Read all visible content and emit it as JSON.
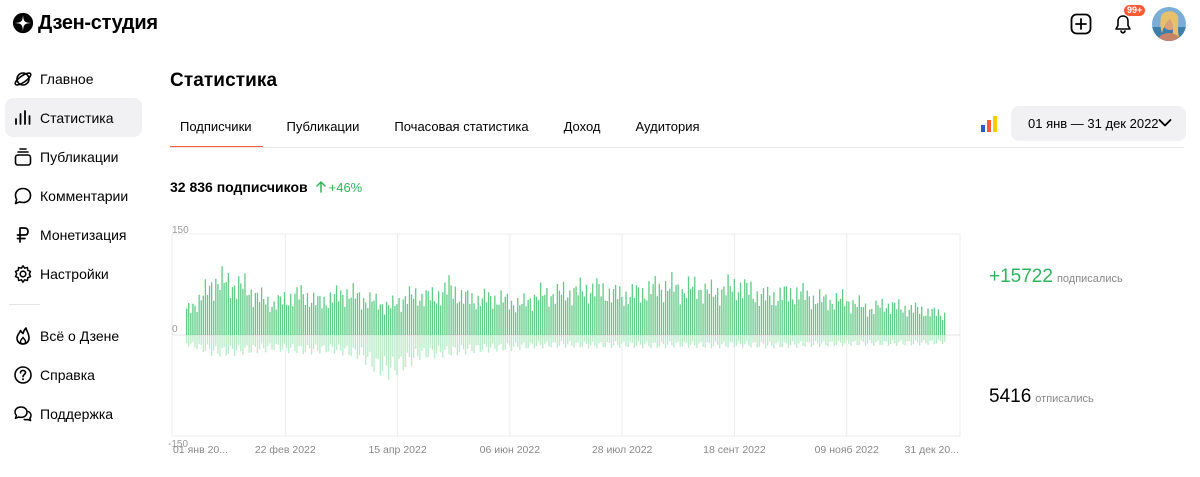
{
  "header": {
    "logo_text": "Дзен-студия",
    "notifications_badge": "99+",
    "icons": [
      "zen-logo-icon",
      "plus-square-icon",
      "bell-icon",
      "avatar"
    ]
  },
  "sidebar": {
    "items": [
      {
        "label": "Главное",
        "icon": "planet-icon"
      },
      {
        "label": "Статистика",
        "icon": "bar-chart-icon",
        "active": true
      },
      {
        "label": "Публикации",
        "icon": "stack-icon"
      },
      {
        "label": "Комментарии",
        "icon": "speech-bubble-icon"
      },
      {
        "label": "Монетизация",
        "icon": "ruble-icon"
      },
      {
        "label": "Настройки",
        "icon": "gear-icon"
      }
    ],
    "bottom_items": [
      {
        "label": "Всё о Дзене",
        "icon": "flame-icon"
      },
      {
        "label": "Справка",
        "icon": "question-circle-icon"
      },
      {
        "label": "Поддержка",
        "icon": "chat-bubbles-icon"
      }
    ]
  },
  "main": {
    "title": "Статистика",
    "tabs": [
      {
        "label": "Подписчики",
        "active": true
      },
      {
        "label": "Публикации"
      },
      {
        "label": "Почасовая статистика"
      },
      {
        "label": "Доход"
      },
      {
        "label": "Аудитория"
      }
    ],
    "date_range": "01 янв — 31 дек 2022",
    "subscribers_total": "32 836 подписчиков",
    "subscribers_growth": "+46%",
    "stats": {
      "subscribed_value": "+15722",
      "subscribed_label": "подписались",
      "unsubscribed_value": "5416",
      "unsubscribed_label": "отписались"
    }
  },
  "colors": {
    "accent": "#ff5a36",
    "positive": "#2fb35c",
    "bar_up": "#5fcb85",
    "bar_down": "#b9ebc8"
  },
  "chart_data": {
    "type": "bar",
    "ylim": [
      -150,
      150
    ],
    "ytick_labels": [
      "150",
      "0",
      "-150"
    ],
    "xtick_labels": [
      "01 янв 20...",
      "22 фев 2022",
      "15 апр 2022",
      "06 июн 2022",
      "28 июл 2022",
      "18 сент 2022",
      "09 нояб 2022",
      "31 дек 20..."
    ],
    "x_range": [
      "2022-01-01",
      "2022-12-31"
    ],
    "grid": true,
    "series": [
      {
        "name": "подписались",
        "points": [
          [
            0,
            35
          ],
          [
            7,
            55
          ],
          [
            14,
            80
          ],
          [
            21,
            75
          ],
          [
            28,
            70
          ],
          [
            35,
            55
          ],
          [
            42,
            45
          ],
          [
            49,
            55
          ],
          [
            56,
            60
          ],
          [
            63,
            48
          ],
          [
            70,
            55
          ],
          [
            77,
            62
          ],
          [
            84,
            54
          ],
          [
            91,
            48
          ],
          [
            98,
            42
          ],
          [
            105,
            55
          ],
          [
            112,
            58
          ],
          [
            119,
            55
          ],
          [
            126,
            70
          ],
          [
            133,
            55
          ],
          [
            140,
            52
          ],
          [
            147,
            55
          ],
          [
            154,
            50
          ],
          [
            161,
            45
          ],
          [
            168,
            58
          ],
          [
            175,
            60
          ],
          [
            182,
            62
          ],
          [
            189,
            65
          ],
          [
            196,
            68
          ],
          [
            203,
            62
          ],
          [
            210,
            58
          ],
          [
            217,
            62
          ],
          [
            224,
            68
          ],
          [
            231,
            72
          ],
          [
            238,
            66
          ],
          [
            245,
            70
          ],
          [
            252,
            62
          ],
          [
            259,
            68
          ],
          [
            266,
            72
          ],
          [
            273,
            60
          ],
          [
            280,
            56
          ],
          [
            287,
            60
          ],
          [
            294,
            62
          ],
          [
            301,
            54
          ],
          [
            308,
            50
          ],
          [
            315,
            52
          ],
          [
            322,
            45
          ],
          [
            329,
            38
          ],
          [
            336,
            45
          ],
          [
            343,
            40
          ],
          [
            350,
            38
          ],
          [
            357,
            34
          ],
          [
            364,
            30
          ]
        ]
      },
      {
        "name": "отписались",
        "points": [
          [
            0,
            -12
          ],
          [
            14,
            -25
          ],
          [
            28,
            -22
          ],
          [
            42,
            -18
          ],
          [
            56,
            -22
          ],
          [
            70,
            -20
          ],
          [
            84,
            -28
          ],
          [
            91,
            -45
          ],
          [
            98,
            -50
          ],
          [
            105,
            -40
          ],
          [
            112,
            -28
          ],
          [
            126,
            -24
          ],
          [
            140,
            -20
          ],
          [
            154,
            -18
          ],
          [
            168,
            -15
          ],
          [
            182,
            -14
          ],
          [
            196,
            -15
          ],
          [
            210,
            -14
          ],
          [
            224,
            -15
          ],
          [
            238,
            -14
          ],
          [
            252,
            -15
          ],
          [
            266,
            -14
          ],
          [
            280,
            -15
          ],
          [
            294,
            -14
          ],
          [
            308,
            -13
          ],
          [
            322,
            -12
          ],
          [
            336,
            -12
          ],
          [
            350,
            -12
          ],
          [
            364,
            -10
          ]
        ]
      }
    ],
    "x_unit": "days since 01 янв 2022"
  }
}
